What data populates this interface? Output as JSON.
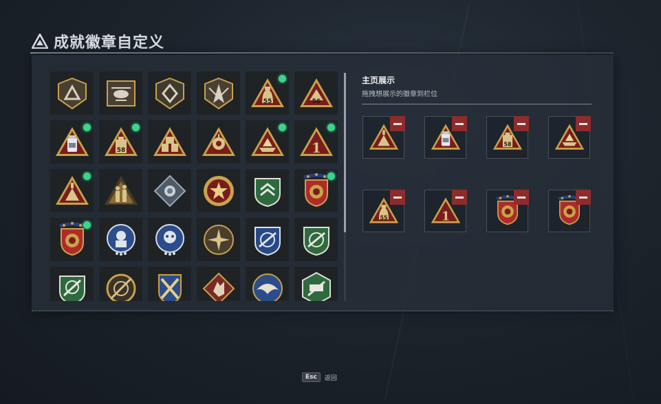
{
  "header": {
    "title": "成就徽章自定义",
    "icon": "triangle-logo-icon"
  },
  "colors": {
    "accent_new": "#38d68a",
    "remove": "#8e2c2c",
    "gold": "#c9a24a",
    "crimson": "#7a1c1c"
  },
  "badge_grid": {
    "rows": [
      [
        {
          "icon": "shield-triangle-emblem",
          "new": false
        },
        {
          "icon": "shield-helicopter-emblem",
          "new": false
        },
        {
          "icon": "shield-diamond-emblem",
          "new": false
        },
        {
          "icon": "shield-wings-emblem",
          "new": false
        },
        {
          "icon": "triangle-bag-55",
          "label": "55",
          "new": true
        },
        {
          "icon": "triangle-56",
          "label": "56",
          "new": false
        }
      ],
      [
        {
          "icon": "triangle-jar",
          "new": true
        },
        {
          "icon": "triangle-box-58",
          "label": "58",
          "new": true
        },
        {
          "icon": "triangle-crates",
          "new": false
        },
        {
          "icon": "triangle-flower",
          "new": false
        },
        {
          "icon": "triangle-boat",
          "new": true
        },
        {
          "icon": "triangle-number-1",
          "label": "1",
          "new": true
        }
      ],
      [
        {
          "icon": "triangle-pyramid",
          "new": true
        },
        {
          "icon": "triangle-soldiers",
          "new": false
        },
        {
          "icon": "diamond-rose",
          "new": false
        },
        {
          "icon": "round-star-medal",
          "new": false
        },
        {
          "icon": "green-chevron-shield",
          "new": false
        },
        {
          "icon": "crest-red-shield",
          "new": true
        }
      ],
      [
        {
          "icon": "crest-red-shield-b",
          "new": true
        },
        {
          "icon": "round-blue-soldier",
          "new": false
        },
        {
          "icon": "round-blue-skull",
          "new": false
        },
        {
          "icon": "round-sun-burst",
          "new": false
        },
        {
          "icon": "blue-arrow-shield",
          "new": false
        },
        {
          "icon": "green-arrow-shield",
          "new": false
        }
      ],
      [
        {
          "icon": "green-scope-shield",
          "new": false
        },
        {
          "icon": "gold-scope-ring",
          "new": false
        },
        {
          "icon": "gold-cross-shield",
          "new": false
        },
        {
          "icon": "red-wolf-diamond",
          "new": false
        },
        {
          "icon": "blue-eagle-round",
          "new": false
        },
        {
          "icon": "green-hex-soldier",
          "new": false
        }
      ]
    ]
  },
  "showcase": {
    "title": "主页展示",
    "subtitle": "拖拽想展示的徽章到栏位",
    "slots": [
      {
        "icon": "triangle-pyramid"
      },
      {
        "icon": "triangle-jar"
      },
      {
        "icon": "triangle-box-58",
        "label": "58"
      },
      {
        "icon": "triangle-boat"
      },
      {
        "icon": "triangle-bag-55",
        "label": "55"
      },
      {
        "icon": "triangle-number-1",
        "label": "1"
      },
      {
        "icon": "crest-red-shield"
      },
      {
        "icon": "crest-red-shield-b"
      }
    ]
  },
  "footer": {
    "esc_key": "Esc",
    "esc_label": "返回"
  }
}
